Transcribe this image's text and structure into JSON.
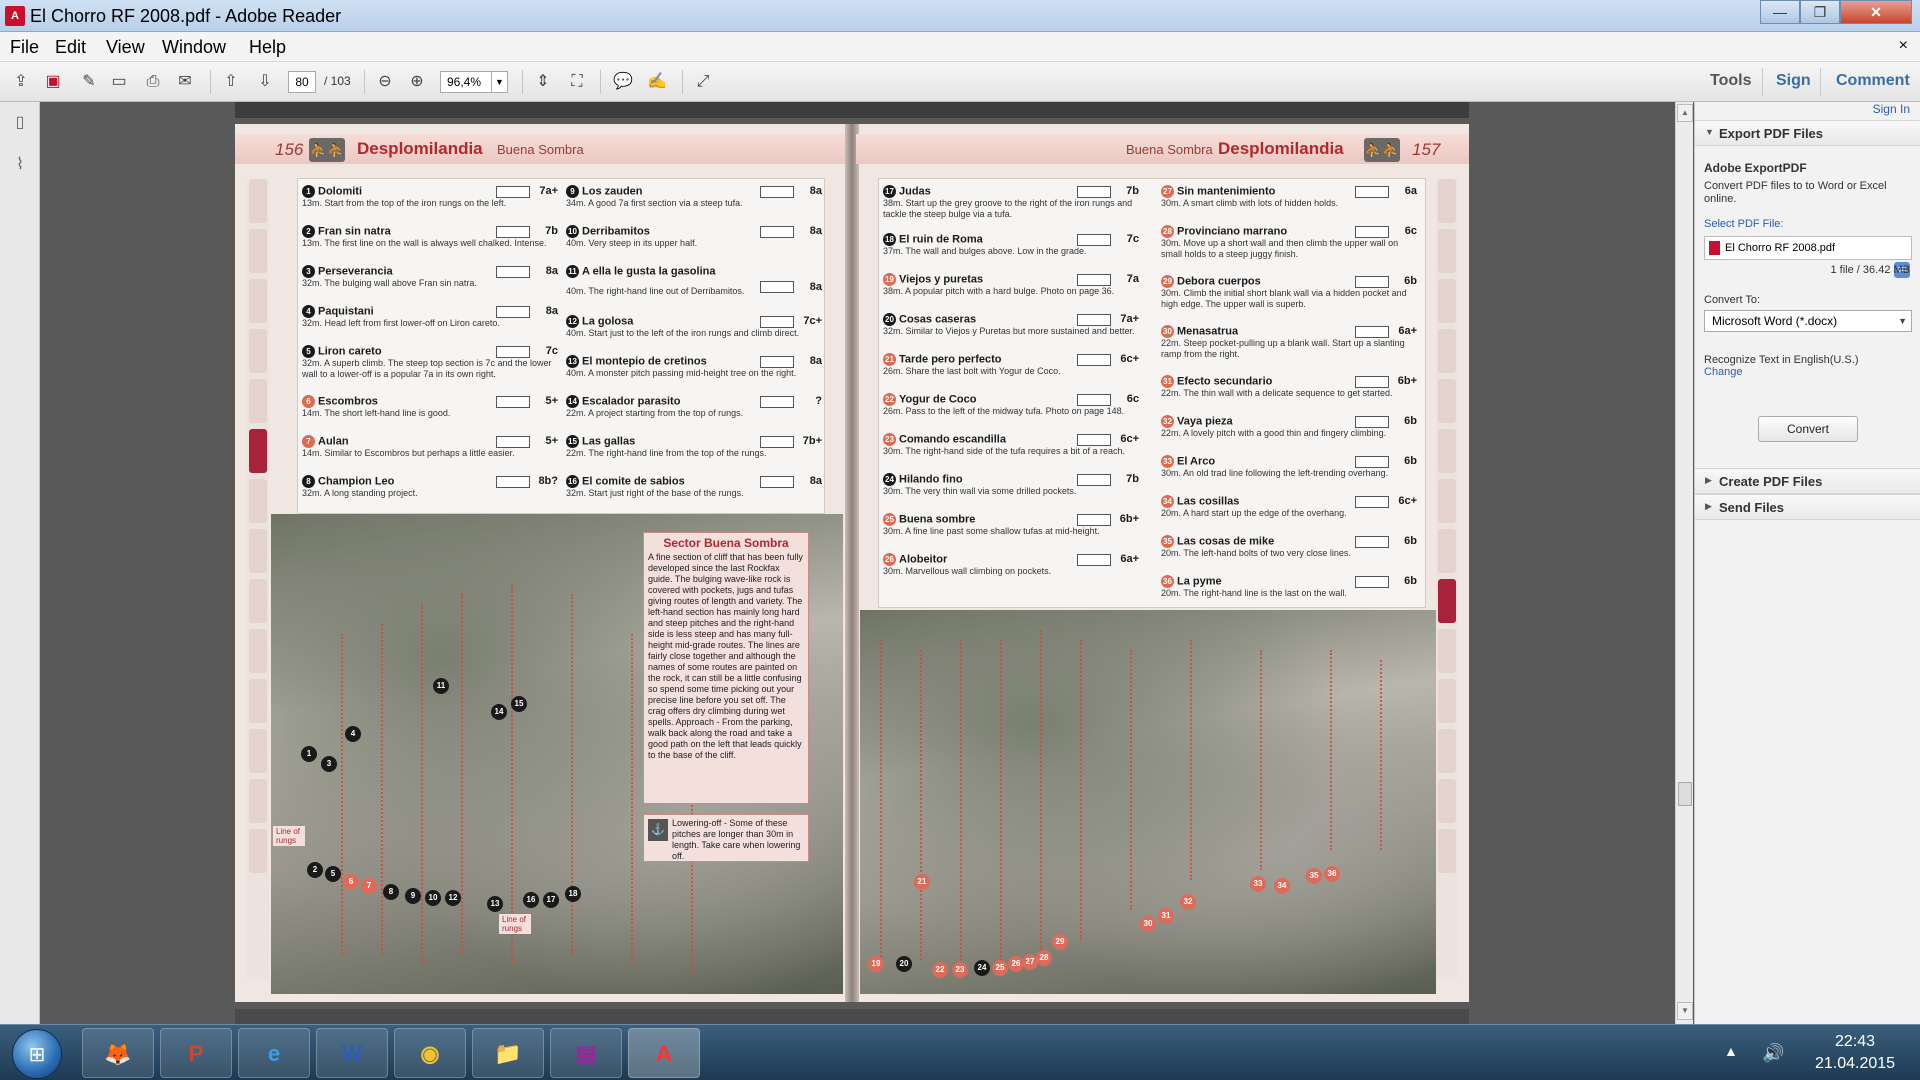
{
  "window": {
    "title": "El Chorro RF 2008.pdf - Adobe Reader",
    "app_icon_label": "A",
    "controls": {
      "minimize": "—",
      "maximize": "❐",
      "close": "✕"
    }
  },
  "menu": {
    "items": [
      "File",
      "Edit",
      "View",
      "Window",
      "Help"
    ],
    "close_doc": "×"
  },
  "toolbar": {
    "current_page": "80",
    "total_pages": "/ 103",
    "zoom": "96,4%",
    "right_tabs": [
      "Tools",
      "Sign",
      "Comment"
    ]
  },
  "document": {
    "left_page": {
      "number": "156",
      "title": "Desplomilandia",
      "subtitle": "Buena Sombra",
      "routes_col1": [
        {
          "num": "1",
          "name": "Dolomiti",
          "grade": "7a+",
          "desc": "13m. Start from the top of the iron rungs on the left."
        },
        {
          "num": "2",
          "name": "Fran sin natra",
          "grade": "7b",
          "desc": "13m. The first line on the wall is always well chalked. Intense."
        },
        {
          "num": "3",
          "name": "Perseverancia",
          "grade": "8a",
          "desc": "32m. The bulging wall above Fran sin natra."
        },
        {
          "num": "4",
          "name": "Paquistani",
          "grade": "8a",
          "desc": "32m. Head left from first lower-off on Liron careto."
        },
        {
          "num": "5",
          "name": "Liron careto",
          "grade": "7c",
          "desc": "32m. A superb climb. The steep top section is 7c and the lower wall to a lower-off is a popular 7a in its own right."
        },
        {
          "num": "6",
          "name": "Escombros",
          "grade": "5+",
          "desc": "14m. The short left-hand line is good."
        },
        {
          "num": "7",
          "name": "Aulan",
          "grade": "5+",
          "desc": "14m. Similar to Escombros but perhaps a little easier."
        },
        {
          "num": "8",
          "name": "Champion Leo",
          "grade": "8b?",
          "desc": "32m. A long standing project."
        }
      ],
      "routes_col2": [
        {
          "num": "9",
          "name": "Los zauden",
          "grade": "8a",
          "desc": "34m. A good 7a first section via a steep tufa."
        },
        {
          "num": "10",
          "name": "Derribamitos",
          "grade": "8a",
          "desc": "40m. Very steep in its upper half."
        },
        {
          "num": "11",
          "name": "A ella le gusta la gasolina",
          "grade": "8a",
          "desc": "40m. The right-hand line out of Derribamitos."
        },
        {
          "num": "12",
          "name": "La golosa",
          "grade": "7c+",
          "desc": "40m. Start just to the left of the iron rungs and climb direct."
        },
        {
          "num": "13",
          "name": "El montepio de cretinos",
          "grade": "8a",
          "desc": "40m. A monster pitch passing mid-height tree on the right."
        },
        {
          "num": "14",
          "name": "Escalador parasito",
          "grade": "?",
          "desc": "22m. A project starting from the top of rungs."
        },
        {
          "num": "15",
          "name": "Las gallas",
          "grade": "7b+",
          "desc": "22m. The right-hand line from the top of the rungs."
        },
        {
          "num": "16",
          "name": "El comite de sabios",
          "grade": "8a",
          "desc": "32m. Start just right of the base of the rungs."
        }
      ],
      "sector": {
        "title": "Sector Buena Sombra",
        "body": "A fine section of cliff that has been fully developed since the last Rockfax guide. The bulging wave-like rock is covered with pockets, jugs and tufas giving routes of length and variety. The left-hand section has mainly long hard and steep pitches and the right-hand side is less steep and has many full-height mid-grade routes. The lines are fairly close together and although the names of some routes are painted on the rock, it can still be a little confusing so spend some time picking out your precise line before you set off. The crag offers dry climbing during wet spells. Approach - From the parking, walk back along the road and take a good path on the left that leads quickly to the base of the cliff."
      },
      "lowering": "Lowering-off - Some of these pitches are longer than 30m in length. Take care when lowering off.",
      "rung_label_1": "Line of rungs",
      "rung_label_2": "Line of rungs",
      "photo_dots": [
        "1",
        "2",
        "3",
        "4",
        "5",
        "6",
        "7",
        "8",
        "9",
        "10",
        "11",
        "12",
        "13",
        "14",
        "15",
        "16",
        "17",
        "18"
      ]
    },
    "right_page": {
      "number": "157",
      "title": "Desplomilandia",
      "subtitle": "Buena Sombra",
      "routes_col1": [
        {
          "num": "17",
          "name": "Judas",
          "grade": "7b",
          "desc": "38m. Start up the grey groove to the right of the iron rungs and tackle the steep bulge via a tufa."
        },
        {
          "num": "18",
          "name": "El ruin de Roma",
          "grade": "7c",
          "desc": "37m. The wall and bulges above. Low in the grade."
        },
        {
          "num": "19",
          "name": "Viejos y puretas",
          "grade": "7a",
          "desc": "38m. A popular pitch with a hard bulge. Photo on page 36."
        },
        {
          "num": "20",
          "name": "Cosas caseras",
          "grade": "7a+",
          "desc": "32m. Similar to Viejos y Puretas but more sustained and better."
        },
        {
          "num": "21",
          "name": "Tarde pero perfecto",
          "grade": "6c+",
          "desc": "26m. Share the last bolt with Yogur de Coco."
        },
        {
          "num": "22",
          "name": "Yogur de Coco",
          "grade": "6c",
          "desc": "26m. Pass to the left of the midway tufa. Photo on page 148."
        },
        {
          "num": "23",
          "name": "Comando escandilla",
          "grade": "6c+",
          "desc": "30m. The right-hand side of the tufa requires a bit of a reach."
        },
        {
          "num": "24",
          "name": "Hilando fino",
          "grade": "7b",
          "desc": "30m. The very thin wall via some drilled pockets."
        },
        {
          "num": "25",
          "name": "Buena sombre",
          "grade": "6b+",
          "desc": "30m. A fine line past some shallow tufas at mid-height."
        },
        {
          "num": "26",
          "name": "Alobeitor",
          "grade": "6a+",
          "desc": "30m. Marvellous wall climbing on pockets."
        }
      ],
      "routes_col2": [
        {
          "num": "27",
          "name": "Sin mantenimiento",
          "grade": "6a",
          "desc": "30m. A smart climb with lots of hidden holds."
        },
        {
          "num": "28",
          "name": "Provinciano marrano",
          "grade": "6c",
          "desc": "30m. Move up a short wall and then climb the upper wall on small holds to a steep juggy finish."
        },
        {
          "num": "29",
          "name": "Debora cuerpos",
          "grade": "6b",
          "desc": "30m. Climb the initial short blank wall via a hidden pocket and high edge. The upper wall is superb."
        },
        {
          "num": "30",
          "name": "Menasatrua",
          "grade": "6a+",
          "desc": "22m. Steep pocket-pulling up a blank wall. Start up a slanting ramp from the right."
        },
        {
          "num": "31",
          "name": "Efecto secundario",
          "grade": "6b+",
          "desc": "22m. The thin wall with a delicate sequence to get started."
        },
        {
          "num": "32",
          "name": "Vaya pieza",
          "grade": "6b",
          "desc": "22m. A lovely pitch with a good thin and fingery climbing."
        },
        {
          "num": "33",
          "name": "El Arco",
          "grade": "6b",
          "desc": "30m. An old trad line following the left-trending overhang."
        },
        {
          "num": "34",
          "name": "Las cosillas",
          "grade": "6c+",
          "desc": "20m. A hard start up the edge of the overhang."
        },
        {
          "num": "35",
          "name": "Las cosas de mike",
          "grade": "6b",
          "desc": "20m. The left-hand bolts of two very close lines."
        },
        {
          "num": "36",
          "name": "La pyme",
          "grade": "6b",
          "desc": "20m. The right-hand line is the last on the wall."
        }
      ],
      "photo_dots": [
        "19",
        "20",
        "21",
        "22",
        "23",
        "24",
        "25",
        "26",
        "27",
        "28",
        "29",
        "30",
        "31",
        "32",
        "33",
        "34",
        "35",
        "36"
      ]
    }
  },
  "right_panel": {
    "sign_in": "Sign In",
    "export_title": "Export PDF Files",
    "service_name": "Adobe ExportPDF",
    "service_desc": "Convert PDF files to to Word or Excel online.",
    "select_label": "Select PDF File:",
    "file_name": "El Chorro RF 2008.pdf",
    "file_info": "1 file / 36.42 MB",
    "convert_to_label": "Convert To:",
    "convert_option": "Microsoft Word (*.docx)",
    "recognize_text": "Recognize Text in English(U.S.)",
    "change_link": "Change",
    "convert_button": "Convert",
    "create_title": "Create PDF Files",
    "send_title": "Send Files"
  },
  "taskbar": {
    "apps": [
      {
        "name": "firefox",
        "glyph": "🦊"
      },
      {
        "name": "powerpoint",
        "glyph": "P"
      },
      {
        "name": "internet-explorer",
        "glyph": "e"
      },
      {
        "name": "word",
        "glyph": "W"
      },
      {
        "name": "chrome",
        "glyph": "◉"
      },
      {
        "name": "file-explorer",
        "glyph": "📁"
      },
      {
        "name": "winrar",
        "glyph": "▤"
      },
      {
        "name": "adobe-reader",
        "glyph": "A"
      }
    ],
    "time": "22:43",
    "date": "21.04.2015"
  }
}
